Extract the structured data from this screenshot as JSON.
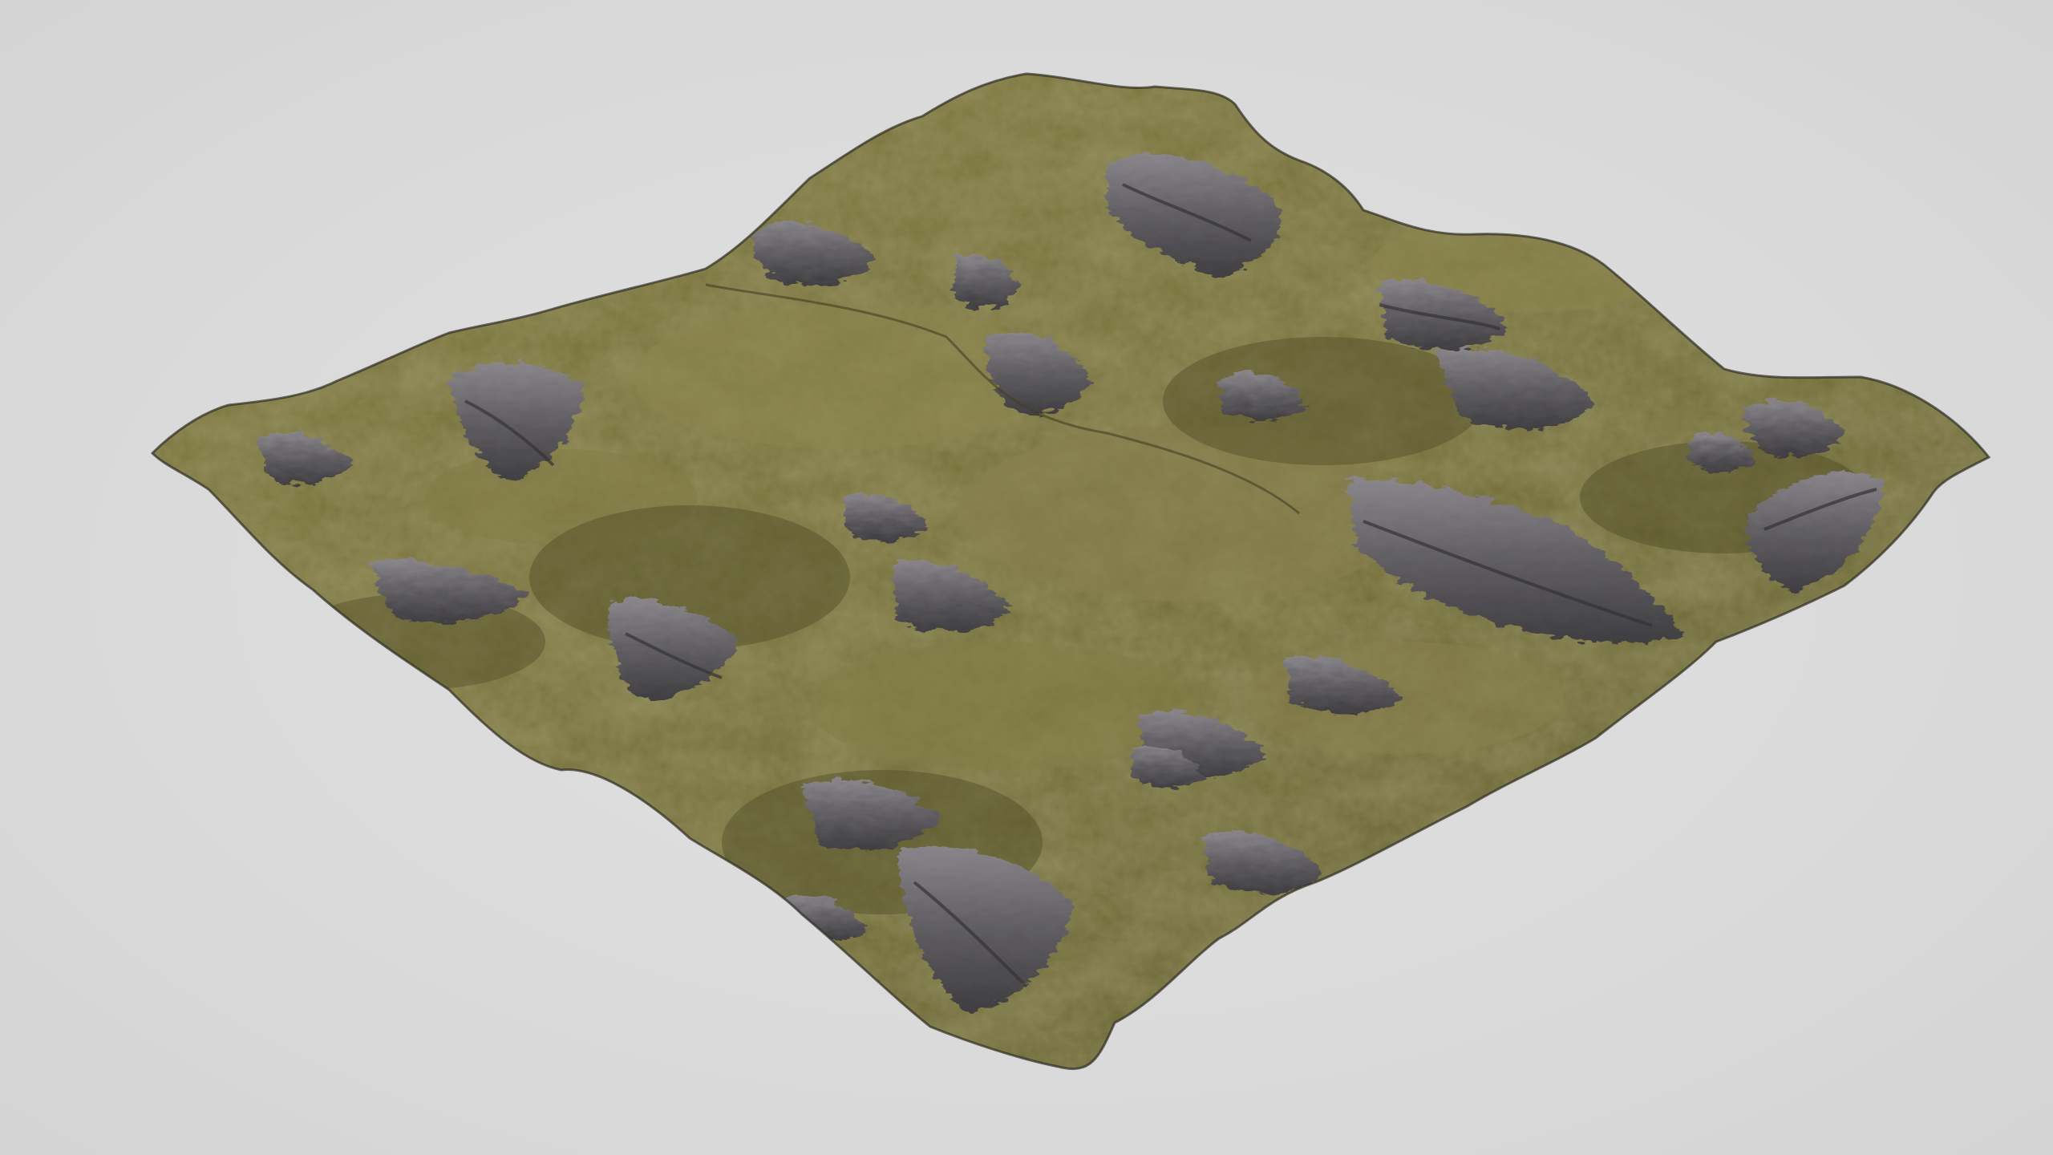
{
  "scene": {
    "subject": "terrain-tile",
    "colors": {
      "background": "#dcdcdc",
      "grass": "#6e6a34",
      "grass_light": "#8a8246",
      "grass_dark": "#4f4c26",
      "rock": "#5e5c63",
      "rock_light": "#8b8892",
      "rock_dark": "#3a3940",
      "edge": "#2e2c22"
    }
  }
}
